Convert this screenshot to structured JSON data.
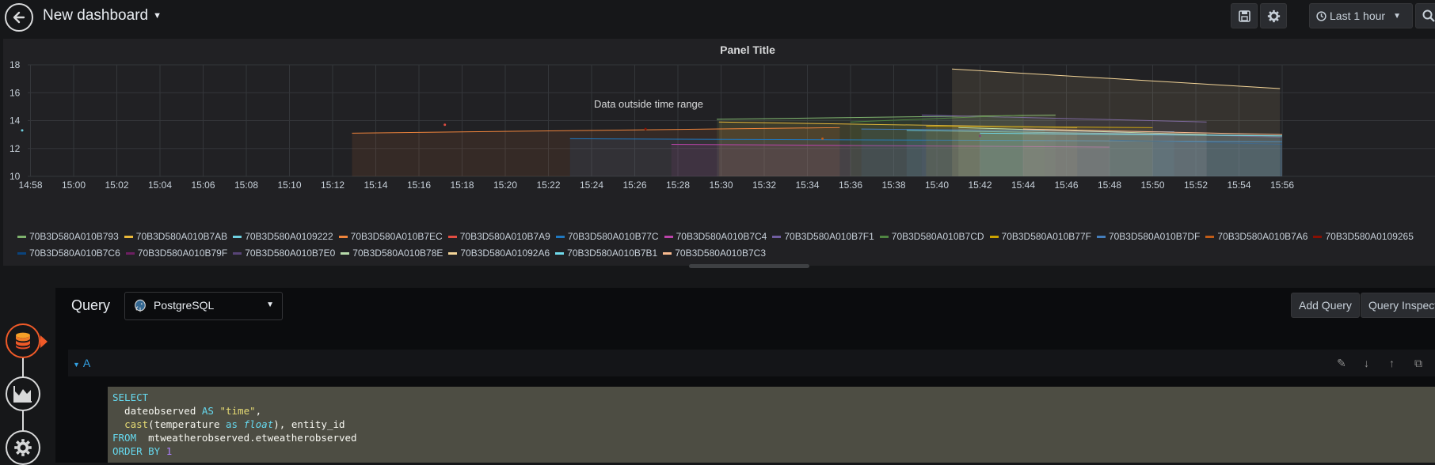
{
  "header": {
    "dashboard_title": "New dashboard",
    "time_picker_label": "Last 1 hour"
  },
  "panel": {
    "title": "Panel Title",
    "annotation": "Data outside time range"
  },
  "chart_data": {
    "type": "line",
    "ylim": [
      10,
      18
    ],
    "yticks": [
      "10",
      "12",
      "14",
      "16",
      "18"
    ],
    "xticks": [
      "14:58",
      "15:00",
      "15:02",
      "15:04",
      "15:06",
      "15:08",
      "15:10",
      "15:12",
      "15:14",
      "15:16",
      "15:18",
      "15:20",
      "15:22",
      "15:24",
      "15:26",
      "15:28",
      "15:30",
      "15:32",
      "15:34",
      "15:36",
      "15:38",
      "15:40",
      "15:42",
      "15:44",
      "15:46",
      "15:48",
      "15:50",
      "15:52",
      "15:54",
      "15:56"
    ],
    "grid": true,
    "legend_position": "bottom",
    "series": [
      {
        "name": "70B3D580A010B793",
        "color": "#7eb26d",
        "points": [
          [
            29.8,
            14.1
          ],
          [
            45.5,
            14.4
          ]
        ]
      },
      {
        "name": "70B3D580A010B7AB",
        "color": "#eab839",
        "points": [
          [
            29.9,
            13.9
          ],
          [
            46.5,
            13.5
          ]
        ]
      },
      {
        "name": "70B3D580A0109222",
        "color": "#6ed0e0",
        "points": [
          [
            38.6,
            13.3
          ],
          [
            56.0,
            12.9
          ]
        ]
      },
      {
        "name": "70B3D580A010B7EC",
        "color": "#ef843c",
        "points": [
          [
            12.9,
            13.1
          ],
          [
            35.5,
            13.5
          ]
        ]
      },
      {
        "name": "70B3D580A010B7A9",
        "color": "#e24d42",
        "points": [
          [
            17.2,
            13.7
          ]
        ]
      },
      {
        "name": "70B3D580A010B77C",
        "color": "#1f78c1",
        "points": [
          [
            23.0,
            12.7
          ],
          [
            56.0,
            12.5
          ]
        ]
      },
      {
        "name": "70B3D580A010B7C4",
        "color": "#ba43a9",
        "points": [
          [
            27.7,
            12.3
          ],
          [
            48.0,
            12.1
          ]
        ]
      },
      {
        "name": "70B3D580A010B7F1",
        "color": "#705da0",
        "points": [
          [
            39.3,
            14.4
          ],
          [
            52.5,
            13.9
          ]
        ]
      },
      {
        "name": "70B3D580A010B7CD",
        "color": "#508642",
        "points": [
          [
            36.0,
            13.9
          ],
          [
            44.0,
            14.4
          ]
        ]
      },
      {
        "name": "70B3D580A010B77F",
        "color": "#cca300",
        "points": [
          [
            39.5,
            13.6
          ],
          [
            50.0,
            13.5
          ]
        ]
      },
      {
        "name": "70B3D580A010B7DF",
        "color": "#447ebc",
        "points": [
          [
            36.5,
            13.4
          ],
          [
            51.0,
            13.2
          ]
        ]
      },
      {
        "name": "70B3D580A010B7A6",
        "color": "#c15c17",
        "points": [
          [
            34.7,
            12.7
          ]
        ]
      },
      {
        "name": "70B3D580A0109265",
        "color": "#890f02",
        "points": [
          [
            26.5,
            13.4
          ]
        ]
      },
      {
        "name": "70B3D580A010B7C6",
        "color": "#0a437c",
        "points": [
          [
            48.0,
            12.6
          ],
          [
            56.0,
            12.3
          ]
        ]
      },
      {
        "name": "70B3D580A010B79F",
        "color": "#6d1f62",
        "points": [
          [
            42.0,
            12.9
          ]
        ]
      },
      {
        "name": "70B3D580A010B7E0",
        "color": "#584477",
        "points": [
          [
            45.0,
            13.3
          ],
          [
            56.0,
            12.8
          ]
        ]
      },
      {
        "name": "70B3D580A010B78E",
        "color": "#b7dbab",
        "points": [
          [
            41.0,
            13.5
          ],
          [
            52.5,
            13.0
          ]
        ]
      },
      {
        "name": "70B3D580A01092A6",
        "color": "#f4d598",
        "points": [
          [
            40.7,
            17.7
          ],
          [
            55.9,
            16.3
          ]
        ]
      },
      {
        "name": "70B3D580A010B7B1",
        "color": "#70dbed",
        "points": [
          [
            42.0,
            13.1
          ],
          [
            56.0,
            12.9
          ]
        ]
      },
      {
        "name": "70B3D580A010B7C3",
        "color": "#f9ba8f",
        "points": [
          [
            44.0,
            13.4
          ],
          [
            56.0,
            13.0
          ]
        ]
      }
    ]
  },
  "editor": {
    "query_label": "Query",
    "datasource": "PostgreSQL",
    "add_query_label": "Add Query",
    "query_inspector_label": "Query Inspector",
    "row_letter": "A",
    "sql_lines": [
      "SELECT",
      "  dateobserved AS \"time\",",
      "  cast(temperature as float), entity_id",
      "FROM  mtweatherobserved.etweatherobserved",
      "ORDER BY 1"
    ]
  }
}
